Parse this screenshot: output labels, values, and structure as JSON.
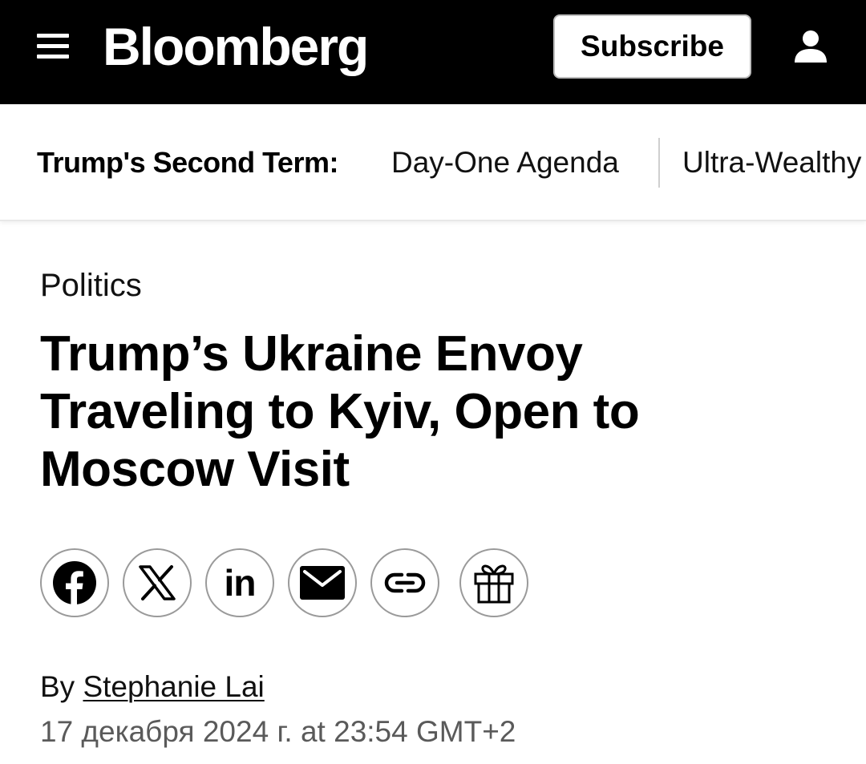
{
  "header": {
    "logo": "Bloomberg",
    "subscribe_label": "Subscribe",
    "background_color": "#000000",
    "icons": [
      "menu-icon",
      "user-icon"
    ]
  },
  "subnav": {
    "label": "Trump's Second Term:",
    "links": [
      "Day-One Agenda",
      "Ultra-Wealthy"
    ]
  },
  "article": {
    "kicker": "Politics",
    "headline": "Trump’s Ukraine Envoy Traveling to Kyiv, Open to Moscow Visit",
    "share_icons": [
      "facebook-icon",
      "x-icon",
      "linkedin-icon",
      "email-icon",
      "link-icon",
      "gift-icon"
    ],
    "linkedin_glyph": "in",
    "byline_prefix": "By",
    "author": "Stephanie Lai",
    "date": "17 декабря 2024 г. at 23:54 GMT+2"
  }
}
